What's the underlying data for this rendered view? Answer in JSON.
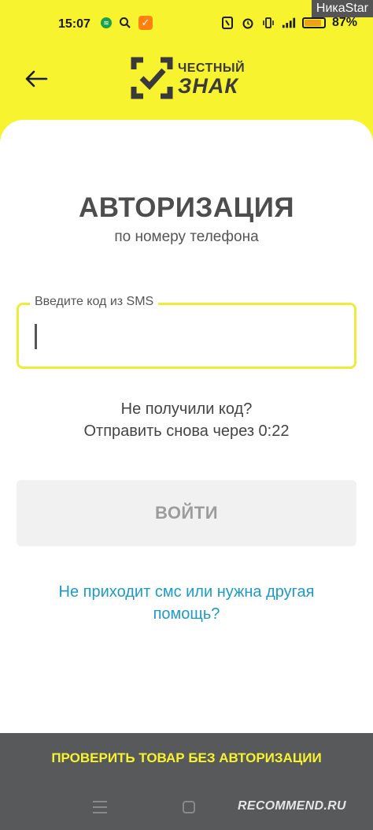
{
  "status_bar": {
    "time": "15:07",
    "battery_percent": "87%",
    "battery_level": 0.87,
    "icons_left": [
      "spotify-icon",
      "search-icon",
      "app-icon"
    ],
    "icons_right": [
      "nfc-icon",
      "alarm-icon",
      "vibrate-icon",
      "signal-icon",
      "battery-icon"
    ]
  },
  "watermark_user": "НикаStar",
  "logo": {
    "line1": "ЧЕСТНЫЙ",
    "line2": "ЗНАК"
  },
  "auth": {
    "title": "АВТОРИЗАЦИЯ",
    "subtitle": "по номеру телефона",
    "code_label": "Введите код из SMS",
    "code_value": "",
    "resend_line1": "Не получили код?",
    "resend_line2": "Отправить снова через 0:22",
    "login_button": "ВОЙТИ",
    "help_link": "Не приходит смс или нужна другая помощь?"
  },
  "footer": {
    "check_without_auth": "ПРОВЕРИТЬ ТОВАР БЕЗ АВТОРИЗАЦИИ"
  },
  "watermark_site": "RECOMMEND.RU",
  "colors": {
    "brand_yellow": "#f7f32e",
    "link_blue": "#1d9bc7",
    "footer_gray": "#58595b"
  }
}
